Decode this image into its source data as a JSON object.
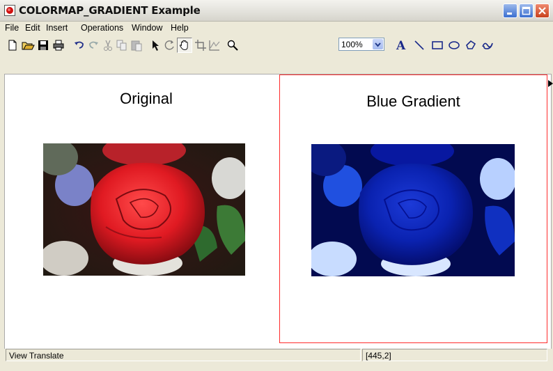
{
  "window": {
    "title": "COLORMAP_GRADIENT Example"
  },
  "menu": [
    "File",
    "Edit",
    "Insert",
    "Operations",
    "Window",
    "Help"
  ],
  "toolbar": {
    "zoom_value": "100%",
    "icons": [
      "new-icon",
      "open-icon",
      "save-icon",
      "print-icon",
      "undo-icon",
      "redo-icon",
      "cut-icon",
      "copy-icon",
      "paste-icon",
      "select-arrow-icon",
      "rotate-icon",
      "pan-hand-icon",
      "crop-icon",
      "profile-icon",
      "zoom-icon",
      "text-tool-icon",
      "line-tool-icon",
      "rectangle-tool-icon",
      "ellipse-tool-icon",
      "polygon-tool-icon",
      "freehand-tool-icon"
    ]
  },
  "panels": {
    "left": {
      "title": "Original",
      "image": "rose-photo"
    },
    "right": {
      "title": "Blue Gradient",
      "image": "rose-blue-gradient"
    }
  },
  "status": {
    "mode": "View Translate",
    "coords": "[445,2]"
  },
  "colors": {
    "selection_border": "#ff2b2b",
    "gradient_blue": "#0022c8"
  }
}
